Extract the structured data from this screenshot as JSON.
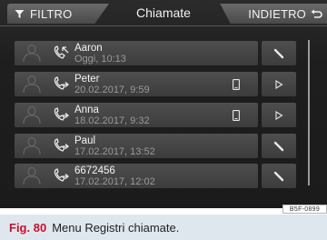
{
  "header": {
    "filter_label": "FILTRO",
    "title": "Chiamate",
    "back_label": "INDIETRO"
  },
  "calls": [
    {
      "name": "Aaron",
      "time": "Oggi, 10:13",
      "direction": "incoming",
      "has_phone_icon": false,
      "action": "pencil-icon"
    },
    {
      "name": "Peter",
      "time": "20.02.2017, 9:59",
      "direction": "outgoing",
      "has_phone_icon": true,
      "action": "play-icon"
    },
    {
      "name": "Anna",
      "time": "18.02.2017, 9:32",
      "direction": "outgoing",
      "has_phone_icon": true,
      "action": "play-icon"
    },
    {
      "name": "Paul",
      "time": "17.02.2017, 13:52",
      "direction": "outgoing",
      "has_phone_icon": false,
      "action": "pencil-icon"
    },
    {
      "name": "6672456",
      "time": "17.02.2017, 12:02",
      "direction": "outgoing",
      "has_phone_icon": false,
      "action": "pencil-icon"
    }
  ],
  "image_code": "B5F-0899",
  "caption": {
    "fig_label": "Fig. 80",
    "text": "Menu Registri chiamate."
  },
  "colors": {
    "screen_bg": "#1b1b1b",
    "row_bg": "#444444",
    "caption_bg": "#dfe7ee",
    "fig_label": "#c8102e"
  }
}
